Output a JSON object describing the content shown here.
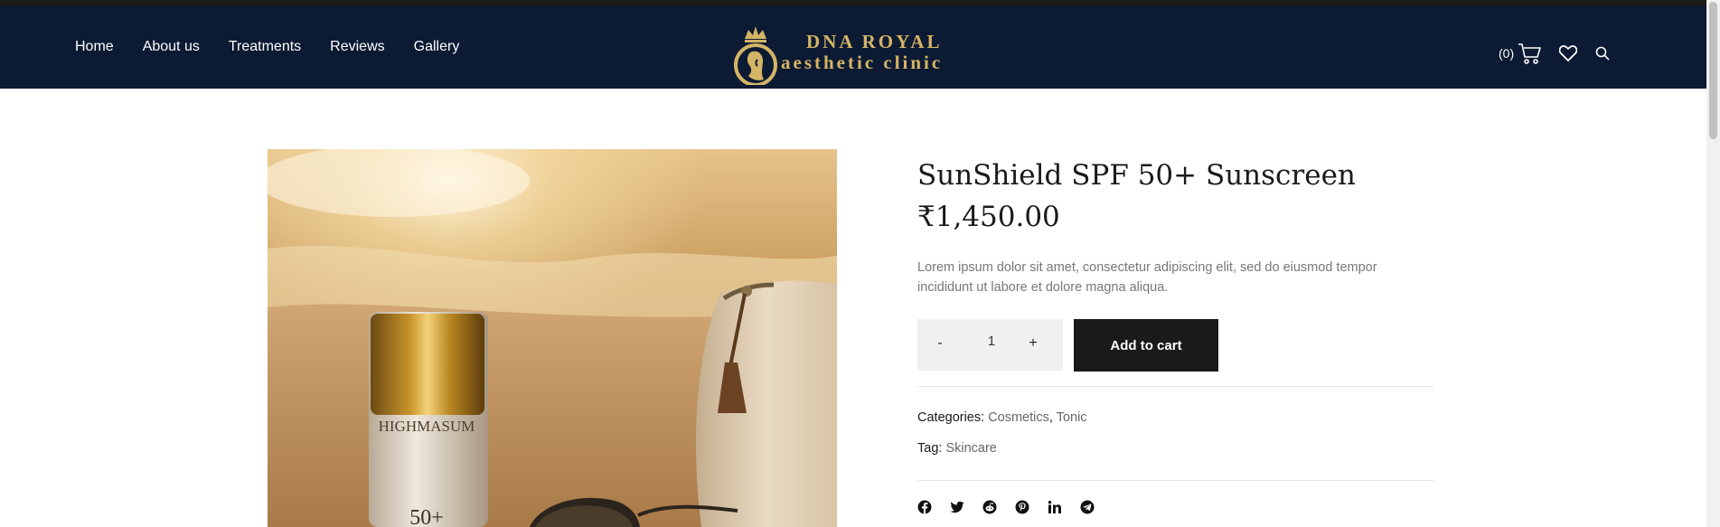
{
  "nav": {
    "links": [
      "Home",
      "About us",
      "Treatments",
      "Reviews",
      "Gallery"
    ],
    "cart_count": "(0)"
  },
  "logo": {
    "line1": "DNA ROYAL",
    "line2": "aesthetic clinic"
  },
  "product": {
    "title": "SunShield SPF 50+ Sunscreen",
    "price": "₹1,450.00",
    "description": "Lorem ipsum dolor sit amet, consectetur adipiscing elit, sed do eiusmod tempor incididunt ut labore et dolore magna aliqua.",
    "quantity": "1",
    "minus": "-",
    "plus": "+",
    "add_to_cart": "Add to cart",
    "categories_label": "Categories:",
    "categories": [
      "Cosmetics",
      "Tonic"
    ],
    "category_sep": ",",
    "tag_label": "Tag:",
    "tag": "Skincare",
    "image_text": {
      "brand": "HIGHMASUM",
      "spf": "50+"
    }
  },
  "share_icons": [
    "facebook-icon",
    "twitter-icon",
    "reddit-icon",
    "pinterest-icon",
    "linkedin-icon",
    "telegram-icon"
  ],
  "colors": {
    "navbar": "#0c1a33",
    "gold": "#d4b465",
    "button": "#1a1a1a",
    "muted": "#777777"
  }
}
